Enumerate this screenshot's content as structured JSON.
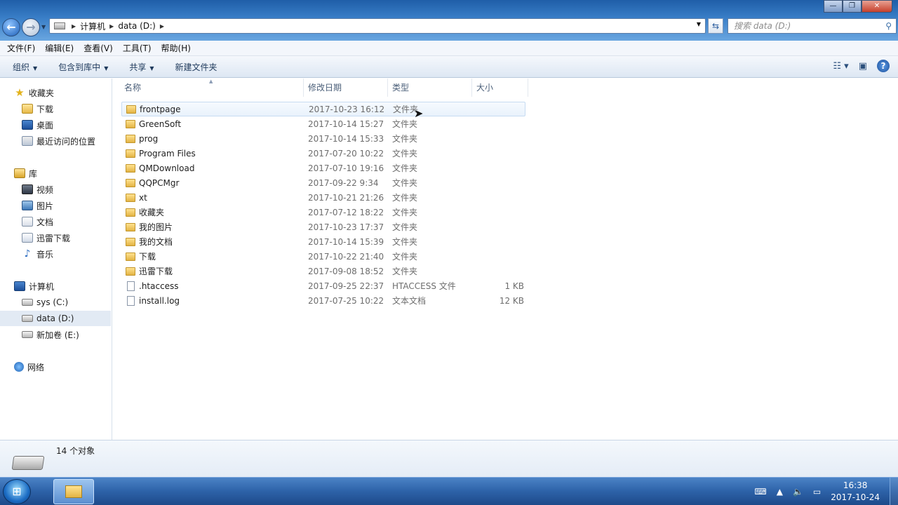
{
  "titlebar": {
    "minimize": "—",
    "maximize": "❐",
    "close": "✕"
  },
  "address": {
    "crumbs": [
      "计算机",
      "data (D:)"
    ],
    "separator": "▶"
  },
  "search": {
    "placeholder": "搜索 data (D:)"
  },
  "menu": [
    "文件(F)",
    "编辑(E)",
    "查看(V)",
    "工具(T)",
    "帮助(H)"
  ],
  "commands": {
    "organize": "组织",
    "include_library": "包含到库中",
    "share": "共享",
    "new_folder": "新建文件夹"
  },
  "nav": {
    "favorites": "收藏夹",
    "downloads": "下载",
    "desktop": "桌面",
    "recent": "最近访问的位置",
    "libraries": "库",
    "videos": "视频",
    "pictures": "图片",
    "documents": "文档",
    "xunlei": "迅雷下载",
    "music": "音乐",
    "computer": "计算机",
    "drive_c": "sys (C:)",
    "drive_d": "data (D:)",
    "drive_e": "新加卷 (E:)",
    "network": "网络"
  },
  "columns": {
    "name": "名称",
    "date": "修改日期",
    "type": "类型",
    "size": "大小"
  },
  "files": [
    {
      "name": "frontpage",
      "date": "2017-10-23 16:12",
      "type": "文件夹",
      "size": "",
      "kind": "folder"
    },
    {
      "name": "GreenSoft",
      "date": "2017-10-14 15:27",
      "type": "文件夹",
      "size": "",
      "kind": "folder"
    },
    {
      "name": "prog",
      "date": "2017-10-14 15:33",
      "type": "文件夹",
      "size": "",
      "kind": "folder"
    },
    {
      "name": "Program Files",
      "date": "2017-07-20 10:22",
      "type": "文件夹",
      "size": "",
      "kind": "folder"
    },
    {
      "name": "QMDownload",
      "date": "2017-07-10 19:16",
      "type": "文件夹",
      "size": "",
      "kind": "folder"
    },
    {
      "name": "QQPCMgr",
      "date": "2017-09-22 9:34",
      "type": "文件夹",
      "size": "",
      "kind": "folder"
    },
    {
      "name": "xt",
      "date": "2017-10-21 21:26",
      "type": "文件夹",
      "size": "",
      "kind": "folder"
    },
    {
      "name": "收藏夹",
      "date": "2017-07-12 18:22",
      "type": "文件夹",
      "size": "",
      "kind": "folder"
    },
    {
      "name": "我的图片",
      "date": "2017-10-23 17:37",
      "type": "文件夹",
      "size": "",
      "kind": "folder"
    },
    {
      "name": "我的文档",
      "date": "2017-10-14 15:39",
      "type": "文件夹",
      "size": "",
      "kind": "folder"
    },
    {
      "name": "下载",
      "date": "2017-10-22 21:40",
      "type": "文件夹",
      "size": "",
      "kind": "folder"
    },
    {
      "name": "迅雷下载",
      "date": "2017-09-08 18:52",
      "type": "文件夹",
      "size": "",
      "kind": "folder"
    },
    {
      "name": ".htaccess",
      "date": "2017-09-25 22:37",
      "type": "HTACCESS 文件",
      "size": "1 KB",
      "kind": "file"
    },
    {
      "name": "install.log",
      "date": "2017-07-25 10:22",
      "type": "文本文档",
      "size": "12 KB",
      "kind": "file"
    }
  ],
  "status": {
    "count": "14 个对象"
  },
  "taskbar": {
    "time": "16:38",
    "date": "2017-10-24"
  }
}
